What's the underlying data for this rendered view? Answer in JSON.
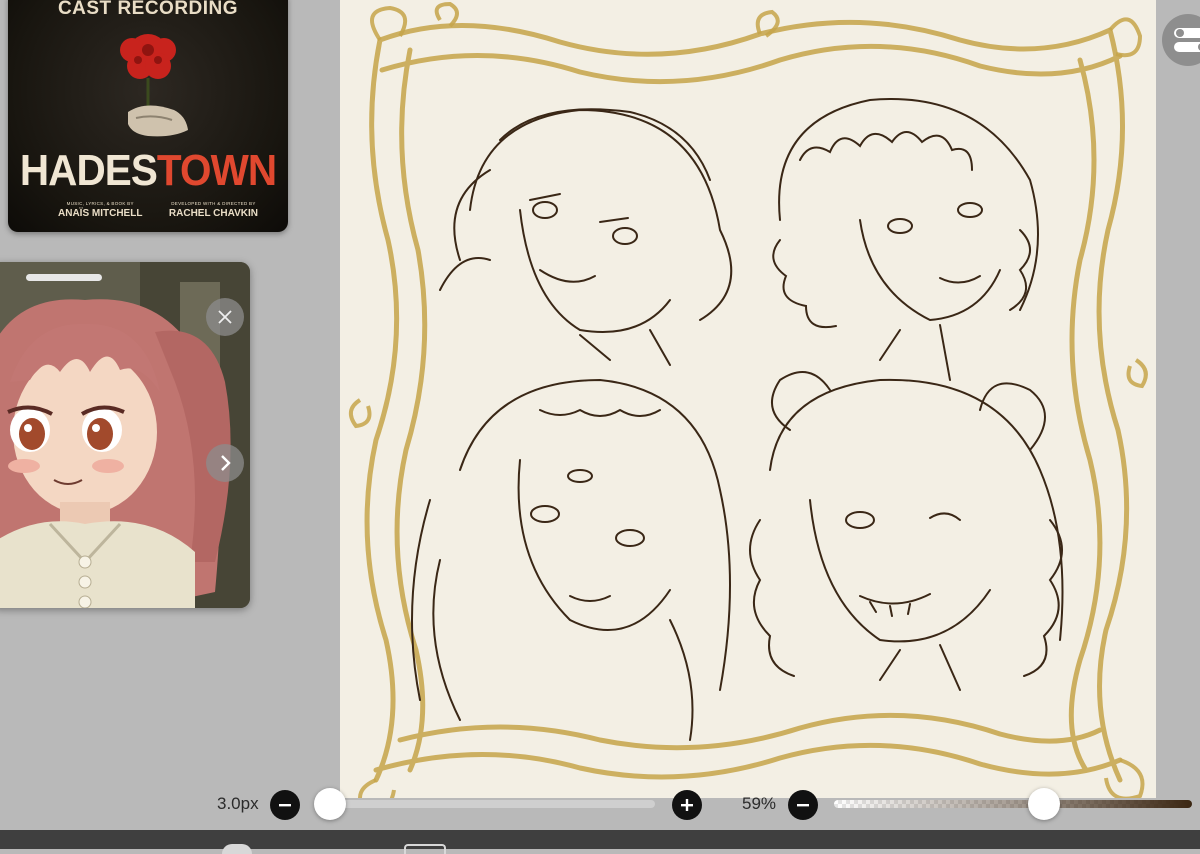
{
  "album": {
    "header": "CAST RECORDING",
    "title_part1": "HADES",
    "title_part2": "TOWN",
    "credit_left_small": "MUSIC, LYRICS, & BOOK BY",
    "credit_left_name": "ANAÏS MITCHELL",
    "credit_right_small": "DEVELOPED WITH & DIRECTED BY",
    "credit_right_name": "RACHEL CHAVKIN"
  },
  "icons": {
    "close": "close-icon",
    "next": "chevron-right-icon",
    "layers": "layer-toggle-icon",
    "minus": "minus-icon",
    "plus": "plus-icon"
  },
  "brush": {
    "size_label": "3.0px",
    "minus_symbol": "−",
    "plus_symbol": "+",
    "size_fraction": 0.0
  },
  "opacity": {
    "label": "59%",
    "minus_symbol": "−",
    "value_percent": 59
  },
  "colors": {
    "frame_gold": "#c6a54a",
    "ink_brown": "#3a2716",
    "paper": "#f3efe4",
    "toolbar_dark": "#3f3f3f"
  }
}
